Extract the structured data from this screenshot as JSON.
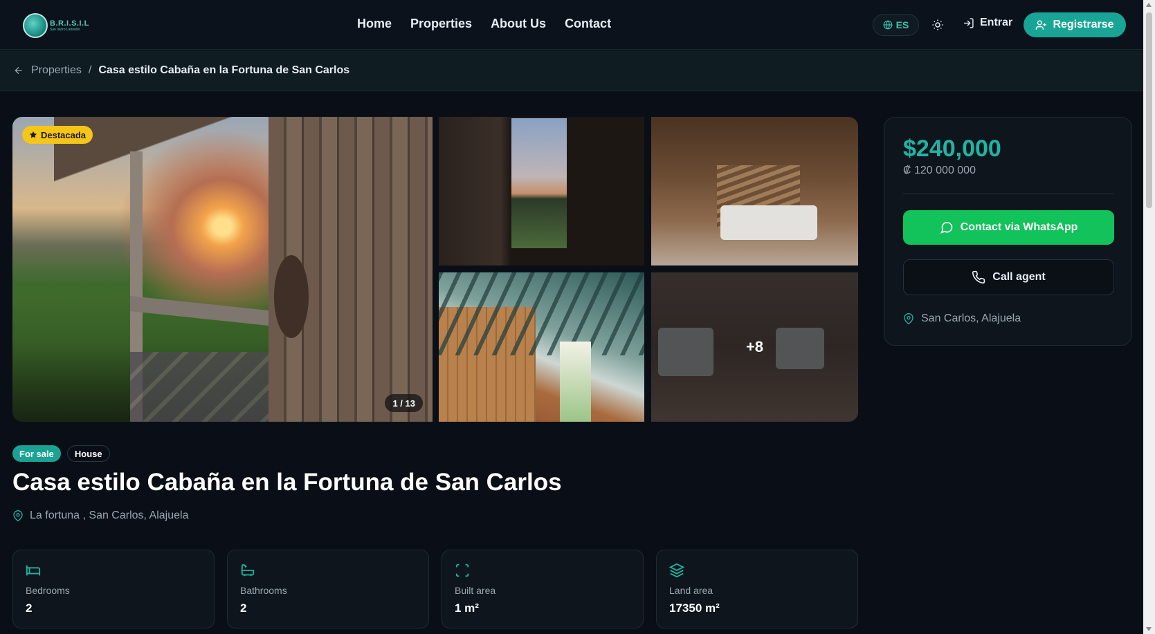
{
  "header": {
    "logo_text": "B.R.I.S.I.L",
    "logo_sub": "San Isidro Labrador",
    "nav": [
      "Home",
      "Properties",
      "About Us",
      "Contact"
    ],
    "lang": "ES",
    "login": "Entrar",
    "register": "Registrarse"
  },
  "breadcrumb": {
    "back": "Properties",
    "separator": "/",
    "current": "Casa estilo Cabaña en la Fortuna de San Carlos"
  },
  "gallery": {
    "featured_badge": "Destacada",
    "counter": "1 / 13",
    "more": "+8"
  },
  "listing": {
    "tags": [
      "For sale",
      "House"
    ],
    "title": "Casa estilo Cabaña en la Fortuna de San Carlos",
    "location": "La fortuna , San Carlos, Alajuela"
  },
  "stats": [
    {
      "label": "Bedrooms",
      "value": "2",
      "icon": "bed-icon"
    },
    {
      "label": "Bathrooms",
      "value": "2",
      "icon": "bath-icon"
    },
    {
      "label": "Built area",
      "value": "1 m²",
      "icon": "area-icon"
    },
    {
      "label": "Land area",
      "value": "17350 m²",
      "icon": "layers-icon"
    }
  ],
  "price_card": {
    "price": "$240,000",
    "price_crc": "₡ 120 000 000",
    "whatsapp": "Contact via WhatsApp",
    "call": "Call agent",
    "location": "San Carlos, Alajuela"
  },
  "colors": {
    "accent": "#1fb5a2",
    "whatsapp": "#12c25a",
    "featured": "#f5c518",
    "background": "#0a0f17"
  }
}
